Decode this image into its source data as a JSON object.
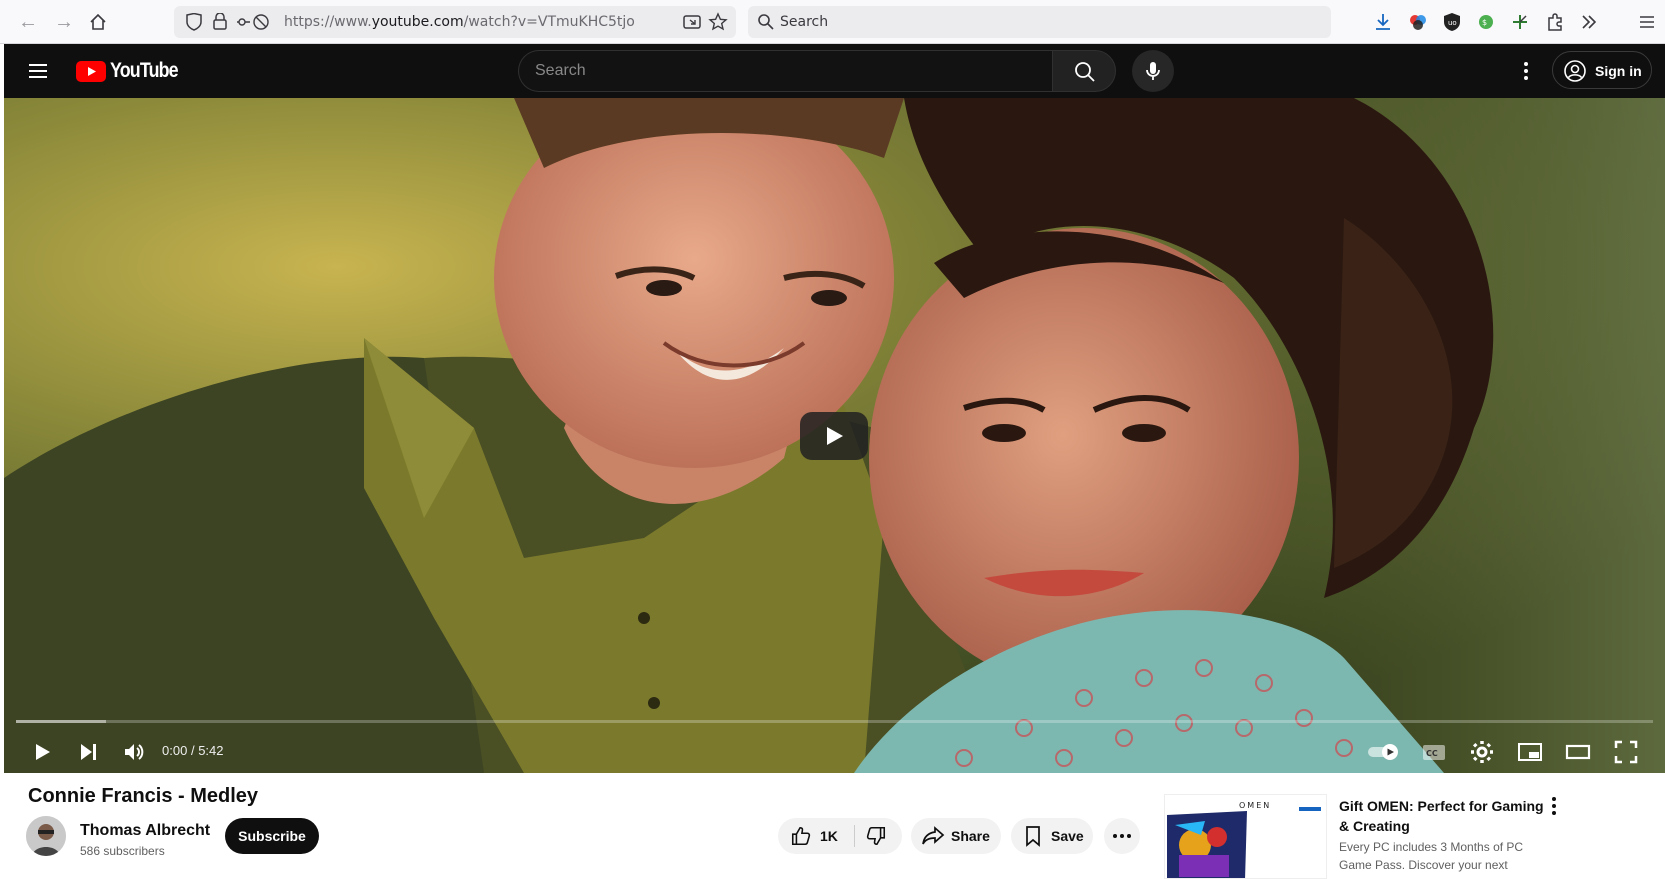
{
  "browser": {
    "url_prefix": "https://www.",
    "url_domain": "youtube.com",
    "url_path": "/watch?v=VTmuKHC5tjo",
    "search_placeholder": "Search"
  },
  "header": {
    "logo_text": "YouTube",
    "search_placeholder": "Search",
    "signin_label": "Sign in"
  },
  "player": {
    "time_current": "0:00",
    "time_separator": "/",
    "time_total": "5:42",
    "progress_buffered_fraction": 0.055
  },
  "video": {
    "title": "Connie Francis - Medley",
    "channel_name": "Thomas Albrecht",
    "subscribers": "586 subscribers",
    "subscribe_label": "Subscribe",
    "like_count": "1K",
    "share_label": "Share",
    "save_label": "Save"
  },
  "ad": {
    "brand": "OMEN",
    "title": "Gift OMEN: Perfect for Gaming & Creating",
    "description": "Every PC includes 3 Months of PC Game Pass. Discover your next"
  },
  "colors": {
    "youtube_red": "#ff0000",
    "header_bg": "#0f0f0f",
    "pill_bg": "#f2f2f2"
  }
}
